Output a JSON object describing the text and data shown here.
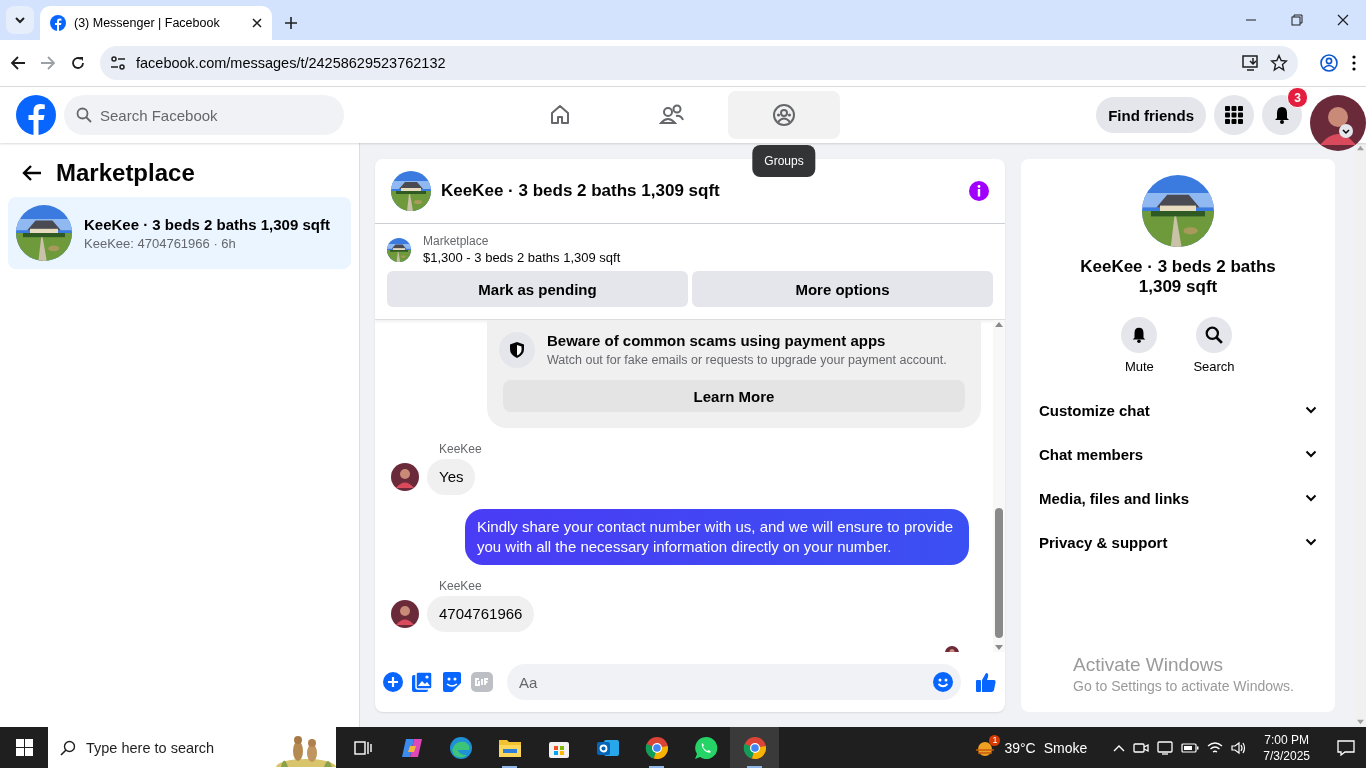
{
  "browser": {
    "tabs": [
      {
        "title": "(3) Messenger | Facebook",
        "selected": true
      }
    ],
    "url": "facebook.com/messages/t/24258629523762132"
  },
  "header": {
    "search_placeholder": "Search Facebook",
    "nav": [
      {
        "kind": "home",
        "hovered": false
      },
      {
        "kind": "friends",
        "hovered": false
      },
      {
        "kind": "groups",
        "hovered": true
      }
    ],
    "tooltip": "Groups",
    "find_friends": "Find friends",
    "notifications_badge": "3"
  },
  "sidebar": {
    "title": "Marketplace",
    "conversations": [
      {
        "title": "KeeKee · 3 beds 2 baths 1,309 sqft",
        "subtitle": "KeeKee: 4704761966 · 6h",
        "selected": true
      }
    ]
  },
  "chat": {
    "title": "KeeKee · 3 beds 2 baths 1,309 sqft",
    "listing": {
      "label": "Marketplace",
      "summary": "$1,300 - 3 beds 2 baths 1,309 sqft"
    },
    "actions": [
      "Mark as pending",
      "More options"
    ],
    "notice": {
      "title": "Beware of common scams using payment apps",
      "text": "Watch out for fake emails or requests to upgrade your payment account.",
      "button": "Learn More"
    },
    "messages": [
      {
        "sender": "KeeKee",
        "text": "Yes",
        "outgoing": false
      },
      {
        "text": "Kindly share your contact number with us, and we will ensure to provide you with all the necessary information directly on your number.",
        "outgoing": true
      },
      {
        "sender": "KeeKee",
        "text": "4704761966",
        "outgoing": false
      }
    ],
    "composer": {
      "placeholder": "Aa"
    }
  },
  "details": {
    "title": "KeeKee · 3 beds 2 baths 1,309 sqft",
    "actions": [
      {
        "kind": "mute",
        "label": "Mute"
      },
      {
        "kind": "search",
        "label": "Search"
      }
    ],
    "sections": [
      "Customize chat",
      "Chat members",
      "Media, files and links",
      "Privacy & support"
    ]
  },
  "os_notice": {
    "title": "Activate Windows",
    "text": "Go to Settings to activate Windows."
  },
  "taskbar": {
    "search_placeholder": "Type here to search",
    "apps": [
      {
        "kind": "taskview",
        "running": false,
        "selected": false
      },
      {
        "kind": "copilot",
        "running": false,
        "selected": false
      },
      {
        "kind": "edge",
        "running": false,
        "selected": false
      },
      {
        "kind": "explorer",
        "running": true,
        "selected": false
      },
      {
        "kind": "store",
        "running": false,
        "selected": false
      },
      {
        "kind": "outlook",
        "running": false,
        "selected": false
      },
      {
        "kind": "chrome",
        "running": true,
        "selected": false
      },
      {
        "kind": "whatsapp",
        "running": false,
        "selected": false
      },
      {
        "kind": "chrome",
        "running": true,
        "selected": true
      }
    ],
    "weather": {
      "badge": "1",
      "temp": "39°C",
      "condition": "Smoke"
    },
    "time": "7:00 PM",
    "date": "7/3/2025"
  }
}
